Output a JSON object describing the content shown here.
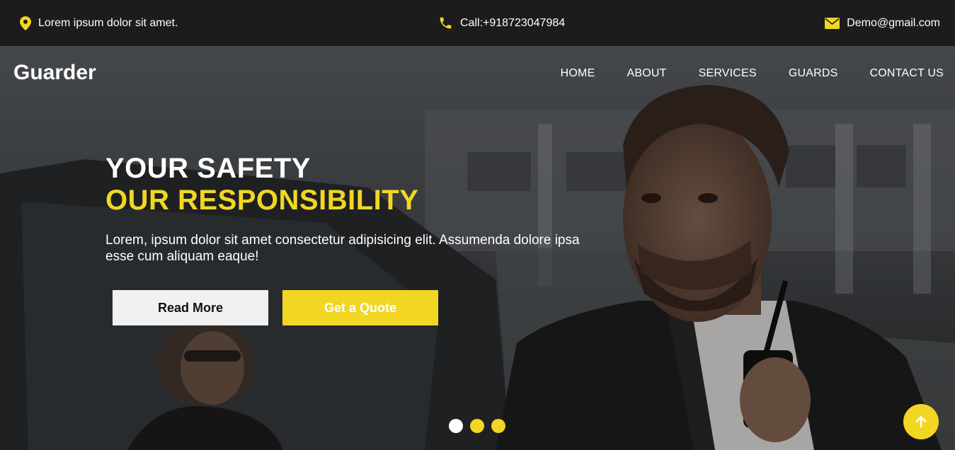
{
  "topbar": {
    "address": "Lorem ipsum dolor sit amet.",
    "phone": "Call:+918723047984",
    "email": "Demo@gmail.com"
  },
  "header": {
    "brand": "Guarder",
    "nav": [
      "HOME",
      "ABOUT",
      "SERVICES",
      "GUARDS",
      "CONTACT US"
    ]
  },
  "hero": {
    "headline_line1": "YOUR SAFETY",
    "headline_line2": "OUR RESPONSIBILITY",
    "description": "Lorem, ipsum dolor sit amet consectetur adipisicing elit. Assumenda dolore ipsa esse cum aliquam eaque!",
    "primary_button": "Read More",
    "secondary_button": "Get a Quote"
  },
  "carousel": {
    "slides": 3,
    "active_index": 0
  },
  "colors": {
    "accent": "#f2d624",
    "topbar_bg": "#1c1c1c",
    "text": "#ffffff"
  },
  "icons": {
    "address": "map-pin-icon",
    "phone": "phone-icon",
    "email": "envelope-icon",
    "scroll_top": "arrow-up-icon"
  }
}
